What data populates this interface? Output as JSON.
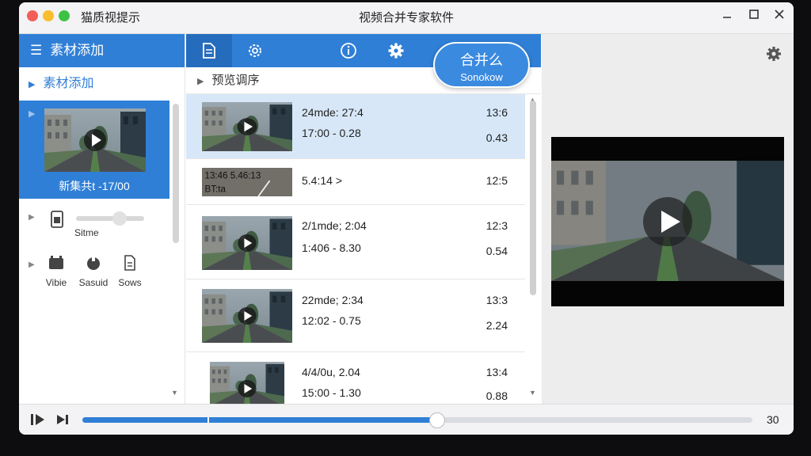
{
  "window": {
    "app_title": "猫质视提示",
    "title": "视频合并专家软件"
  },
  "sidebar": {
    "header": "素材添加",
    "section": "素材添加",
    "selected_caption": "新集共t -17/00",
    "slider_label": "Sitme",
    "tools": [
      {
        "label": "Vibie",
        "icon": "video-icon"
      },
      {
        "label": "Sasuid",
        "icon": "audio-icon"
      },
      {
        "label": "Sows",
        "icon": "document-icon"
      }
    ]
  },
  "toolbar": {
    "merge_label": "合并么",
    "merge_sub": "Sonokow"
  },
  "preview": {
    "header": "预览调序",
    "clips": [
      {
        "line1": "24mde: 27:4",
        "line2": "17:00 - 0.28",
        "right1": "13:6",
        "right2": "0.43",
        "selected": true
      },
      {
        "line1": "5.4:14 >",
        "line2": "",
        "right1": "12:5",
        "right2": "",
        "selected": false,
        "thumb_text1": "13:46  5.46:13",
        "thumb_text2": "BT:ta"
      },
      {
        "line1": "2/1mde; 2:04",
        "line2": "1:406 - 8.30",
        "right1": "12:3",
        "right2": "0.54",
        "selected": false
      },
      {
        "line1": "22mde; 2:34",
        "line2": "12:02 - 0.75",
        "right1": "13:3",
        "right2": "2.24",
        "selected": false
      },
      {
        "line1": "4/4/0u, 2.04",
        "line2": "15:00 - 1.30",
        "right1": "13:4",
        "right2": "0.88",
        "selected": false
      }
    ]
  },
  "playback": {
    "progress": 0.53,
    "time_end": "30"
  },
  "colors": {
    "accent": "#2f7fd6",
    "selected_row": "#d7e7f8"
  }
}
